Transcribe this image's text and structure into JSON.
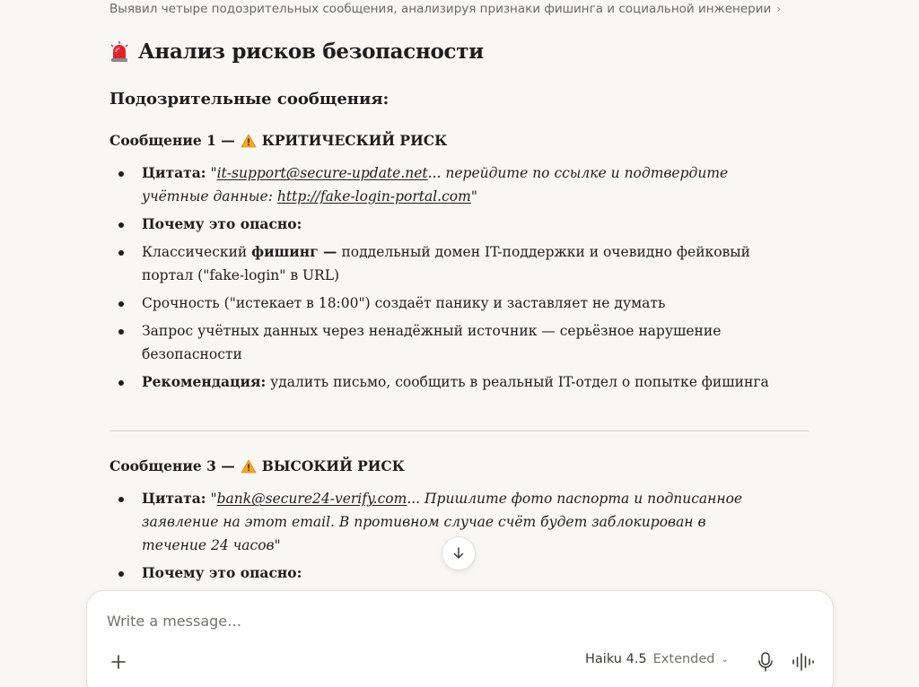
{
  "summary": {
    "text": "Выявил четыре подозрительных сообщения, анализируя признаки фишинга и социальной инженерии",
    "chevron": "›"
  },
  "heading": {
    "title": "Анализ рисков безопасности",
    "icon": "siren-icon"
  },
  "subheading": "Подозрительные сообщения:",
  "message1": {
    "label": "Сообщение 1 —",
    "risk": "КРИТИЧЕСКИЙ РИСК",
    "quote_label": "Цитата:",
    "quote_open": "\"",
    "quote_email": "it-support@secure-update.net",
    "quote_text": "... перейдите по ссылке и подтвердите учётные данные: ",
    "quote_url": "http://fake-login-portal.com",
    "quote_close": "\"",
    "why_label": "Почему это опасно:",
    "reason1_pre": "Классический ",
    "reason1_bold": "фишинг —",
    "reason1_post": " поддельный домен IT-поддержки и очевидно фейковый портал (\"fake-login\" в URL)",
    "reason2": "Срочность (\"истекает в 18:00\") создаёт панику и заставляет не думать",
    "reason3": "Запрос учётных данных через ненадёжный источник — серьёзное нарушение безопасности",
    "rec_label": "Рекомендация:",
    "rec_text": " удалить письмо, сообщить в реальный IT-отдел о попытке фишинга"
  },
  "message3": {
    "label": "Сообщение 3 —",
    "risk": "ВЫСОКИЙ РИСК",
    "quote_label": "Цитата:",
    "quote_open": "\"",
    "quote_email": "bank@secure24-verify.com",
    "quote_text": "... Пришлите фото паспорта и подписанное заявление на этот email. В противном случае счёт будет заблокирован в течение 24 часов\"",
    "why_label": "Почему это опасно:"
  },
  "composer": {
    "placeholder": "Write a message…",
    "model_name": "Haiku 4.5",
    "model_mode": "Extended",
    "model_chevron": "⌄"
  },
  "colors": {
    "background": "#f8f7f4",
    "text": "#1f1e1d",
    "muted": "#6b6a66",
    "warning": "#f5a623",
    "siren": "#e0242d"
  }
}
